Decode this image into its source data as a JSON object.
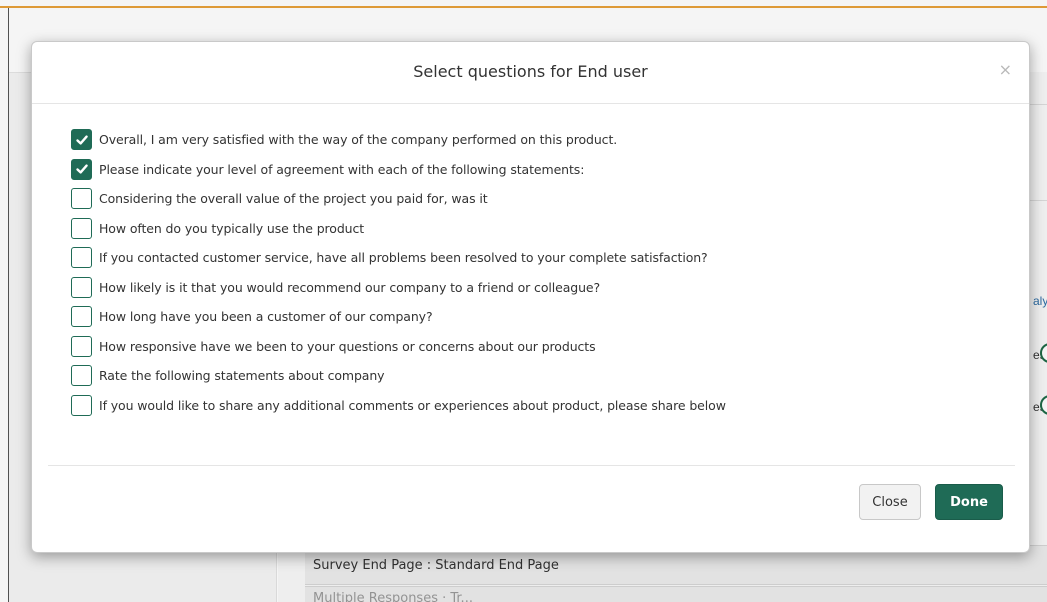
{
  "modal": {
    "title": "Select questions for End user",
    "close_x": "×",
    "questions": [
      {
        "label": "Overall, I am very satisfied with the way of the company performed on this product.",
        "checked": true
      },
      {
        "label": "Please indicate your level of agreement with each of the following statements:",
        "checked": true
      },
      {
        "label": "Considering the overall value of the project you paid for, was it",
        "checked": false
      },
      {
        "label": "How often do you typically use the product",
        "checked": false
      },
      {
        "label": "If you contacted customer service, have all problems been resolved to your complete satisfaction?",
        "checked": false
      },
      {
        "label": "How likely is it that you would recommend our company to a friend or colleague?",
        "checked": false
      },
      {
        "label": "How long have you been a customer of our company?",
        "checked": false
      },
      {
        "label": "How responsive have we been to your questions or concerns about our products",
        "checked": false
      },
      {
        "label": "Rate the following statements about company",
        "checked": false
      },
      {
        "label": "If you would like to share any additional comments or experiences about product, please share below",
        "checked": false
      }
    ],
    "close_label": "Close",
    "done_label": "Done"
  },
  "background": {
    "right_snippet_link": "aly",
    "right_snippet_1": "es",
    "right_snippet_2": "es",
    "survey_end_page": "Survey End Page : Standard End Page",
    "partial_row": "Multiple Responses  ·  Tr..."
  },
  "colors": {
    "accent": "#1f6b56",
    "top_border": "#e8a13a",
    "link": "#2f6fa7"
  },
  "icons": {
    "checkmark": "check-icon",
    "close": "close-icon"
  }
}
